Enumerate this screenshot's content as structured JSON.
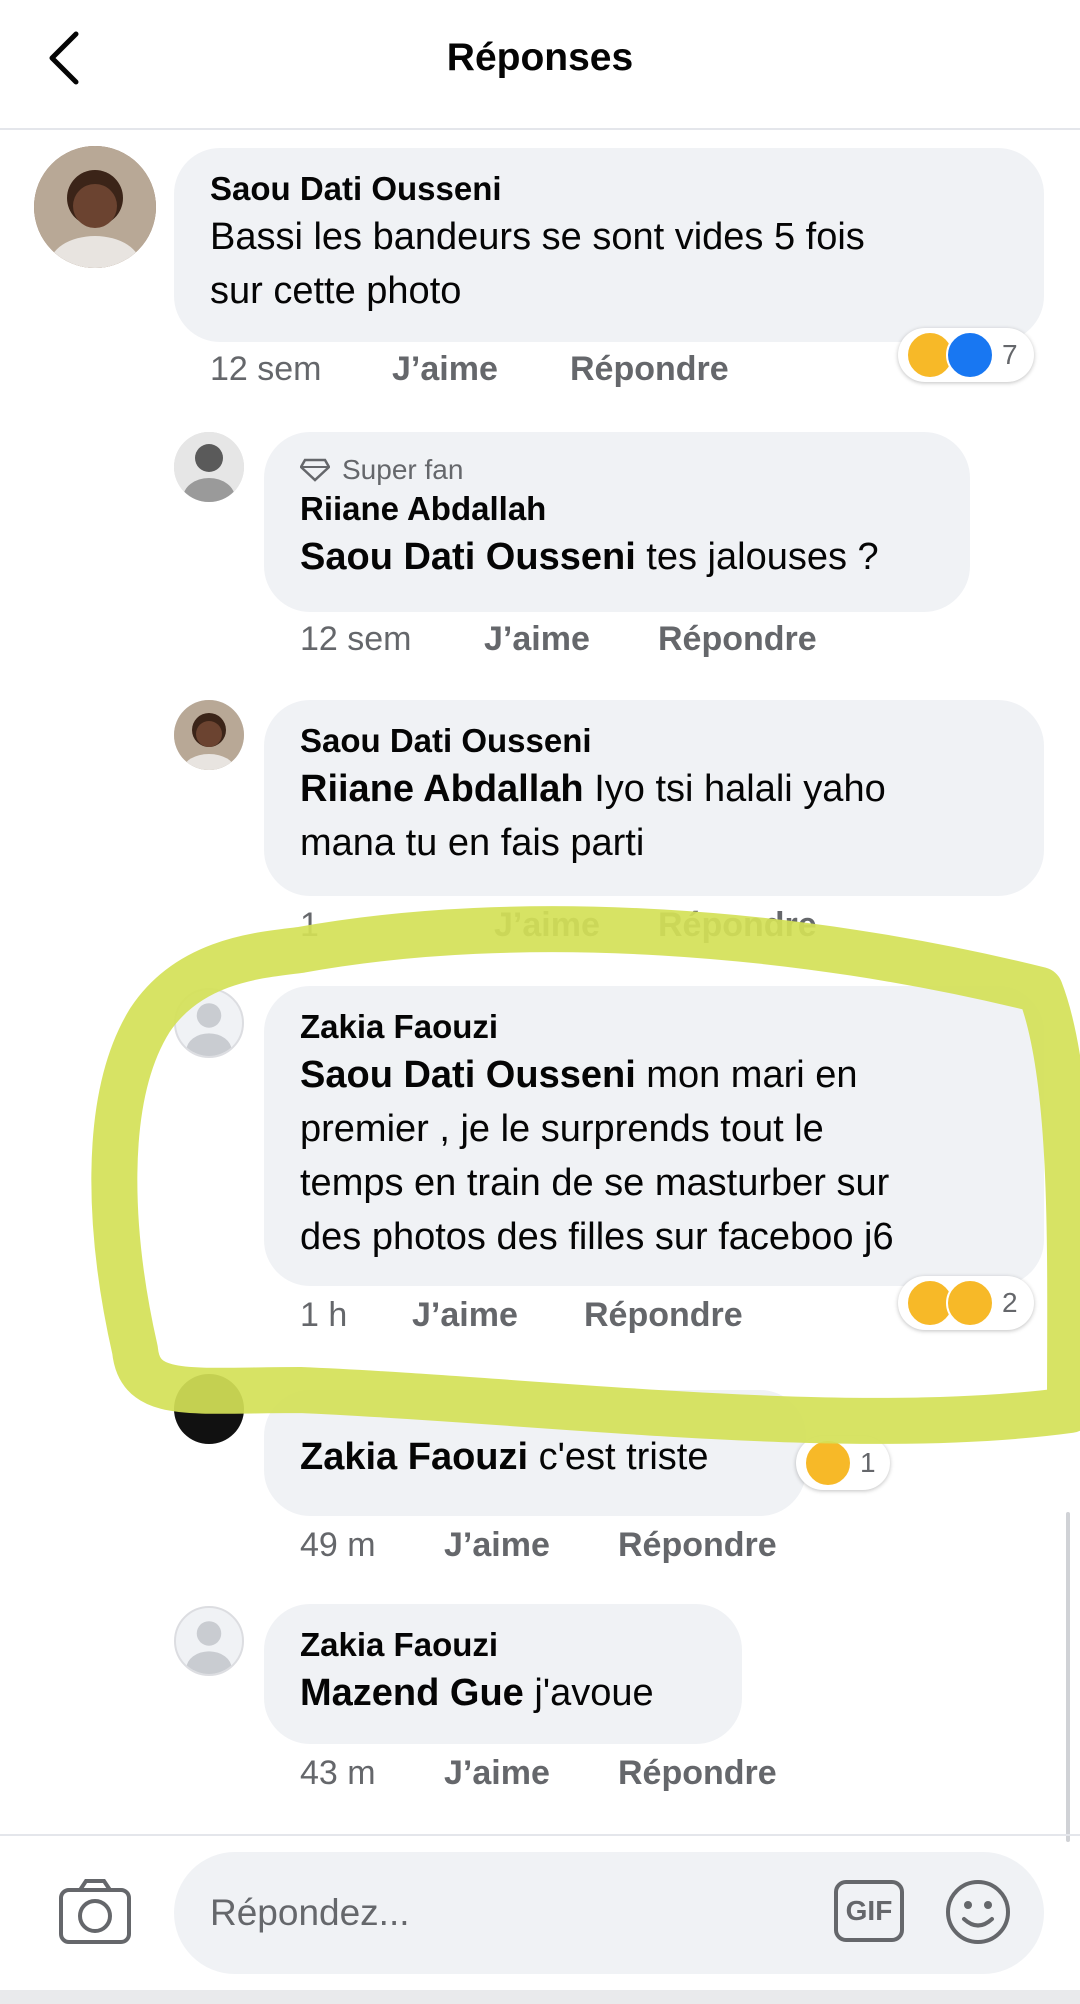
{
  "header": {
    "title": "Réponses"
  },
  "comments": [
    {
      "name": "Saou Dati Ousseni",
      "text": "Bassi les bandeurs se sont vides 5 fois sur cette photo",
      "line1": "Bassi les bandeurs se sont vides 5 fois",
      "line2": "sur cette photo",
      "time": "12 sem",
      "like": "J’aime",
      "reply": "Répondre",
      "reaction_count": "7"
    },
    {
      "badge": "Super fan",
      "name": "Riiane Abdallah",
      "mention": "Saou Dati Ousseni",
      "text": " tes jalouses ?",
      "time": "12 sem",
      "like": "J’aime",
      "reply": "Répondre"
    },
    {
      "name": "Saou Dati Ousseni",
      "mention": "Riiane Abdallah",
      "text": " Iyo tsi halali yaho",
      "line2": "mana tu en fais parti",
      "time": "1",
      "like": "J’aime",
      "reply": "Répondre"
    },
    {
      "name": "Zakia Faouzi",
      "mention": "Saou Dati Ousseni",
      "text": " mon mari en",
      "line2": "premier , je le surprends tout le",
      "line3": "temps en train de se masturber sur",
      "line4": "des photos des filles sur faceboo j6",
      "time": "1 h",
      "like": "J’aime",
      "reply": "Répondre",
      "reaction_count": "2"
    },
    {
      "mention": "Zakia Faouzi",
      "text": " c'est triste",
      "time": "49 m",
      "like": "J’aime",
      "reply": "Répondre",
      "reaction_count": "1"
    },
    {
      "name": "Zakia Faouzi",
      "mention": "Mazend Gue",
      "text": " j'avoue",
      "time": "43 m",
      "like": "J’aime",
      "reply": "Répondre"
    }
  ],
  "composer": {
    "placeholder": "Répondez...",
    "gif_label": "GIF"
  },
  "colors": {
    "bubble": "#f0f2f5",
    "meta": "#65676b",
    "highlight": "#d4e157",
    "like_blue": "#1877f2"
  },
  "icons": [
    "back-arrow-icon",
    "diamond-icon",
    "camera-icon",
    "gif-icon",
    "smiley-icon"
  ]
}
